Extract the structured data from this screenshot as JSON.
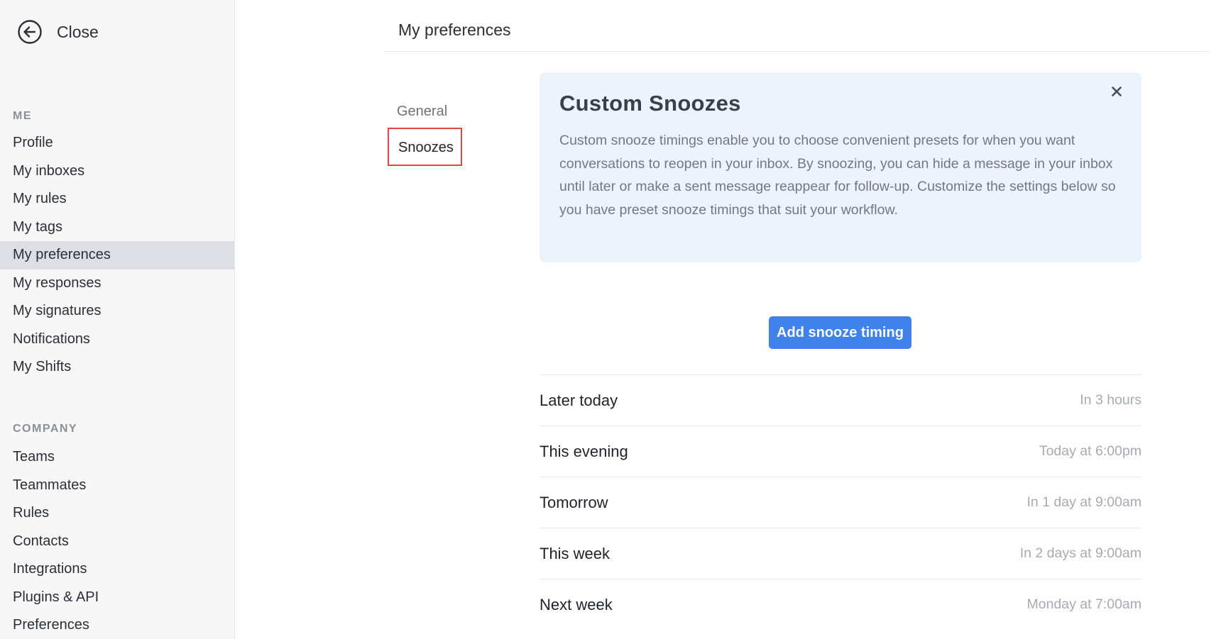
{
  "sidebar": {
    "close_label": "Close",
    "me_label": "ME",
    "me_items": [
      {
        "label": "Profile"
      },
      {
        "label": "My inboxes"
      },
      {
        "label": "My rules"
      },
      {
        "label": "My tags"
      },
      {
        "label": "My preferences",
        "active": true
      },
      {
        "label": "My responses"
      },
      {
        "label": "My signatures"
      },
      {
        "label": "Notifications"
      },
      {
        "label": "My Shifts"
      }
    ],
    "company_label": "COMPANY",
    "company_items": [
      {
        "label": "Teams"
      },
      {
        "label": "Teammates"
      },
      {
        "label": "Rules"
      },
      {
        "label": "Contacts"
      },
      {
        "label": "Integrations"
      },
      {
        "label": "Plugins & API"
      },
      {
        "label": "Preferences"
      }
    ]
  },
  "header": {
    "title": "My preferences"
  },
  "subnav": {
    "general": "General",
    "snoozes": "Snoozes",
    "selected": "Snoozes"
  },
  "info_card": {
    "title": "Custom Snoozes",
    "body": "Custom snooze timings enable you to choose convenient presets for when you want conversations to reopen in your inbox. By snoozing, you can hide a message in your inbox until later or make a sent message reappear for follow-up. Customize the settings below so you have preset snooze timings that suit your workflow."
  },
  "add_button_label": "Add snooze timing",
  "snoozes": [
    {
      "name": "Later today",
      "time": "In 3 hours"
    },
    {
      "name": "This evening",
      "time": "Today at 6:00pm"
    },
    {
      "name": "Tomorrow",
      "time": "In 1 day at 9:00am"
    },
    {
      "name": "This week",
      "time": "In 2 days at 9:00am"
    },
    {
      "name": "Next week",
      "time": "Monday at 7:00am"
    }
  ],
  "colors": {
    "accent": "#3e82ea",
    "highlight_border": "#e04a3a",
    "card_background": "#edf3fd",
    "active_nav": "#dddfe6"
  },
  "icons": {
    "close": "arrow-left-circle-icon",
    "card_close": "x-icon"
  }
}
